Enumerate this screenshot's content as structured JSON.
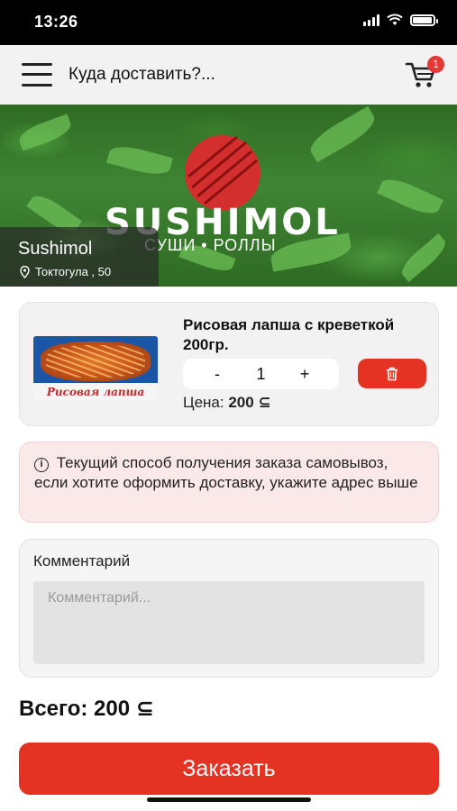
{
  "status_bar": {
    "time": "13:26"
  },
  "header": {
    "title": "Куда доставить?...",
    "cart_count": "1"
  },
  "banner": {
    "brand": "SUSHIMOL",
    "tagline": "СУШИ • РОЛЛЫ",
    "store_name": "Sushimol",
    "store_address": "Токтогула , 50"
  },
  "cart_item": {
    "image_caption": "Рисовая лапша",
    "name": "Рисовая лапша с креветкой 200гр.",
    "qty_minus": "-",
    "quantity": "1",
    "qty_plus": "+",
    "price_label": "Цена:",
    "price_value": "200 ⊆"
  },
  "notice": {
    "icon": "info-icon",
    "text": "Текущий способ получения заказа самовывоз, если хотите оформить доставку, укажите адрес выше"
  },
  "comment": {
    "label": "Комментарий",
    "placeholder": "Комментарий...",
    "value": ""
  },
  "total": {
    "label": "Всего:",
    "value": "200 ⊆"
  },
  "order_button": {
    "label": "Заказать"
  },
  "colors": {
    "accent": "#e53323",
    "notice_bg": "#fbe9ea",
    "card_bg": "#f2f2f2",
    "header_bg": "#f2f2f2"
  }
}
